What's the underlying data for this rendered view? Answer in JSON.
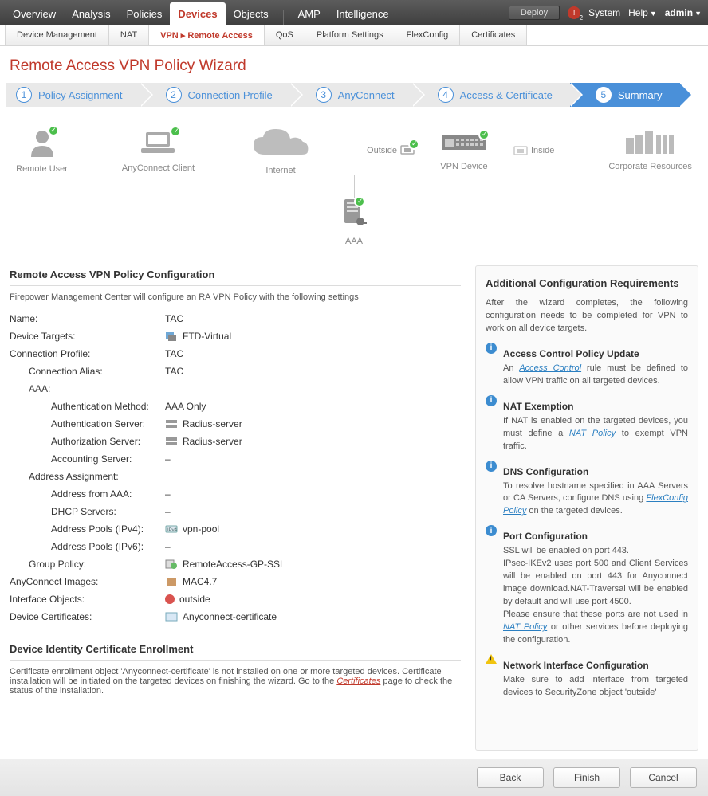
{
  "topnav": {
    "tabs": [
      "Overview",
      "Analysis",
      "Policies",
      "Devices",
      "Objects",
      "AMP",
      "Intelligence"
    ],
    "active": "Devices",
    "deploy": "Deploy",
    "alert_badge": "2",
    "system": "System",
    "help": "Help",
    "user": "admin"
  },
  "subnav": {
    "tabs": [
      "Device Management",
      "NAT",
      "VPN ▸ Remote Access",
      "QoS",
      "Platform Settings",
      "FlexConfig",
      "Certificates"
    ],
    "active": "VPN ▸ Remote Access"
  },
  "page_title": "Remote Access VPN Policy Wizard",
  "wizard_steps": [
    {
      "n": "1",
      "label": "Policy Assignment"
    },
    {
      "n": "2",
      "label": "Connection Profile"
    },
    {
      "n": "3",
      "label": "AnyConnect"
    },
    {
      "n": "4",
      "label": "Access & Certificate"
    },
    {
      "n": "5",
      "label": "Summary"
    }
  ],
  "wizard_active_index": 4,
  "diagram": {
    "remote_user": "Remote User",
    "anyconnect": "AnyConnect Client",
    "internet": "Internet",
    "outside": "Outside",
    "vpn_device": "VPN Device",
    "inside": "Inside",
    "corp": "Corporate Resources",
    "aaa": "AAA"
  },
  "summary": {
    "heading": "Remote Access VPN Policy Configuration",
    "desc": "Firepower Management Center will configure an RA VPN Policy with the following settings",
    "name_k": "Name:",
    "name_v": "TAC",
    "targets_k": "Device Targets:",
    "targets_v": "FTD-Virtual",
    "profile_k": "Connection Profile:",
    "profile_v": "TAC",
    "alias_k": "Connection Alias:",
    "alias_v": "TAC",
    "aaa_k": "AAA:",
    "auth_method_k": "Authentication Method:",
    "auth_method_v": "AAA Only",
    "auth_server_k": "Authentication Server:",
    "auth_server_v": "Radius-server",
    "authz_server_k": "Authorization Server:",
    "authz_server_v": "Radius-server",
    "acct_server_k": "Accounting Server:",
    "acct_server_v": "–",
    "addr_assign_k": "Address Assignment:",
    "addr_aaa_k": "Address from AAA:",
    "addr_aaa_v": "–",
    "dhcp_k": "DHCP Servers:",
    "dhcp_v": "–",
    "pools4_k": "Address Pools (IPv4):",
    "pools4_v": "vpn-pool",
    "pools6_k": "Address Pools (IPv6):",
    "pools6_v": "–",
    "gp_k": "Group Policy:",
    "gp_v": "RemoteAccess-GP-SSL",
    "ac_img_k": "AnyConnect Images:",
    "ac_img_v": "MAC4.7",
    "if_obj_k": "Interface Objects:",
    "if_obj_v": "outside",
    "dev_cert_k": "Device Certificates:",
    "dev_cert_v": "Anyconnect-certificate",
    "enroll_heading": "Device Identity Certificate Enrollment",
    "enroll_p1": "Certificate enrollment object 'Anyconnect-certificate' is not installed on one or more targeted devices. Certificate installation will be initiated on the targeted devices on finishing the wizard. Go to the ",
    "enroll_link": "Certificates",
    "enroll_p2": " page to check the status of the installation."
  },
  "reqs": {
    "heading": "Additional Configuration Requirements",
    "intro": "After the wizard completes, the following configuration needs to be completed for VPN to work on all device targets.",
    "acp_h": "Access Control Policy Update",
    "acp_t1": "An ",
    "acp_link": "Access Control",
    "acp_t2": " rule must be defined to allow VPN traffic on all targeted devices.",
    "nat_h": "NAT Exemption",
    "nat_t1": "If NAT is enabled on the targeted devices, you must define a ",
    "nat_link": "NAT Policy",
    "nat_t2": " to exempt VPN traffic.",
    "dns_h": "DNS Configuration",
    "dns_t1": "To resolve hostname specified in AAA Servers or CA Servers, configure DNS using ",
    "dns_link": "FlexConfig Policy",
    "dns_t2": " on the targeted devices.",
    "port_h": "Port Configuration",
    "port_t1": "SSL will be enabled on port 443.",
    "port_t2": "IPsec-IKEv2 uses port 500 and Client Services will be enabled on port 443 for Anyconnect image download.NAT-Traversal will be enabled by default and will use port 4500.",
    "port_t3a": "Please ensure that these ports are not used in ",
    "port_link": "NAT Policy",
    "port_t3b": " or other services before deploying the configuration.",
    "nic_h": "Network Interface Configuration",
    "nic_t": "Make sure to add interface from targeted devices to SecurityZone object 'outside'"
  },
  "footer": {
    "back": "Back",
    "finish": "Finish",
    "cancel": "Cancel"
  }
}
